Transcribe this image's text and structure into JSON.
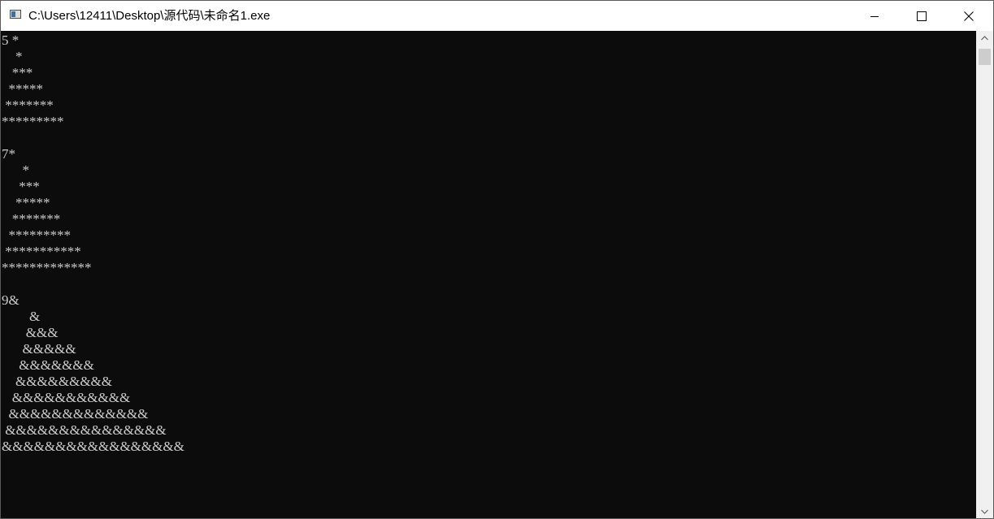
{
  "window": {
    "title": "C:\\Users\\12411\\Desktop\\源代码\\未命名1.exe",
    "icon": "console-app-icon",
    "controls": [
      "minimize-icon",
      "maximize-icon",
      "close-icon"
    ]
  },
  "console": {
    "text_color": "#cccccc",
    "background_color": "#0c0c0c",
    "lines": [
      "5 *",
      "    *",
      "   ***",
      "  *****",
      " *******",
      "*********",
      "",
      "7*",
      "      *",
      "     ***",
      "    *****",
      "   *******",
      "  *********",
      " ***********",
      "*************",
      "",
      "9&",
      "        &",
      "       &&&",
      "      &&&&&",
      "     &&&&&&&",
      "    &&&&&&&&&",
      "   &&&&&&&&&&&",
      "  &&&&&&&&&&&&&",
      " &&&&&&&&&&&&&&&",
      "&&&&&&&&&&&&&&&&&"
    ]
  },
  "scrollbar": {
    "icons": [
      "scroll-up-arrow-icon",
      "scroll-down-arrow-icon"
    ]
  }
}
